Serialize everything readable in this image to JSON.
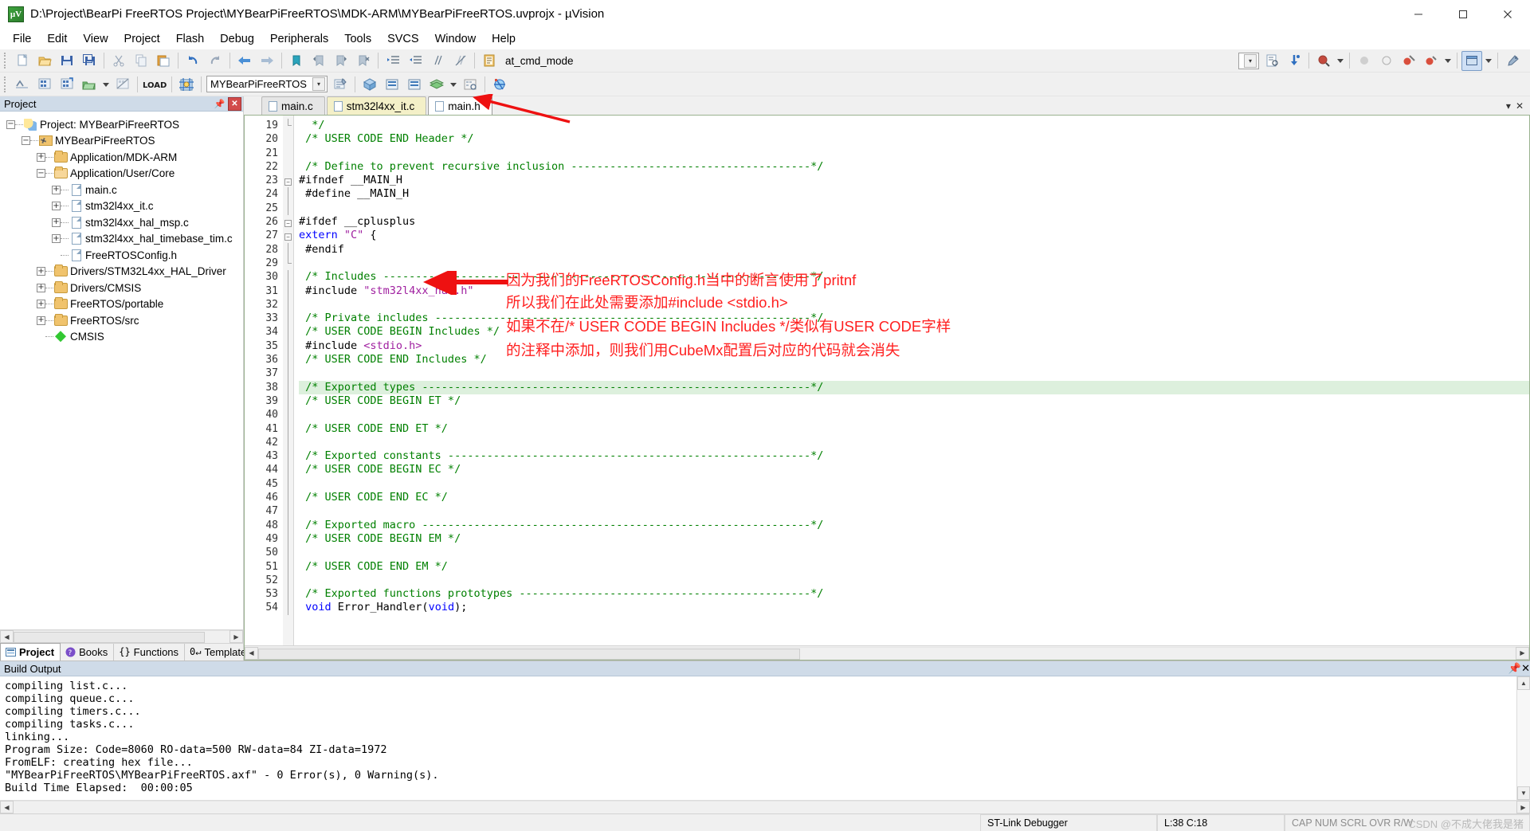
{
  "window": {
    "title": "D:\\Project\\BearPi FreeRTOS Project\\MYBearPiFreeRTOS\\MDK-ARM\\MYBearPiFreeRTOS.uvprojx - µVision",
    "app_icon": "uvision-icon",
    "minimize": "−",
    "maximize": "❐",
    "close": "✕"
  },
  "menubar": {
    "items": [
      {
        "label": "File"
      },
      {
        "label": "Edit"
      },
      {
        "label": "View"
      },
      {
        "label": "Project"
      },
      {
        "label": "Flash"
      },
      {
        "label": "Debug"
      },
      {
        "label": "Peripherals"
      },
      {
        "label": "Tools"
      },
      {
        "label": "SVCS"
      },
      {
        "label": "Window"
      },
      {
        "label": "Help"
      }
    ]
  },
  "toolbar1": {
    "combo_value": "at_cmd_mode",
    "buttons": [
      "new-file-icon",
      "open-file-icon",
      "save-icon",
      "save-all-icon",
      "cut-icon",
      "copy-icon",
      "paste-icon",
      "undo-icon",
      "redo-icon",
      "navigate-back-icon",
      "navigate-forward-icon",
      "bookmark-toggle-icon",
      "bookmark-prev-icon",
      "bookmark-next-icon",
      "bookmark-clear-icon",
      "indent-icon",
      "outdent-icon",
      "comment-icon",
      "uncomment-icon",
      "bookmark-list-icon",
      "find-icon",
      "debug-start-icon",
      "debug-stop-icon",
      "insert-breakpoint-icon",
      "window-layout-icon",
      "configure-icon"
    ]
  },
  "toolbar2": {
    "target_value": "MYBearPiFreeRTOS",
    "buttons": [
      "translate-icon",
      "build-icon",
      "rebuild-icon",
      "batch-build-icon",
      "stop-build-icon",
      "load-icon",
      "target-options-icon",
      "manage-project-items-icon",
      "options-icon",
      "insert-icon",
      "new-icon",
      "remove-icon"
    ]
  },
  "project_panel": {
    "caption": "Project",
    "pin_icon": "pin-icon",
    "close_icon": "close-icon",
    "tree": [
      {
        "depth": 0,
        "label": "Project: MYBearPiFreeRTOS",
        "expander": "−",
        "icon": "project-icon"
      },
      {
        "depth": 1,
        "label": "MYBearPiFreeRTOS",
        "expander": "−",
        "icon": "target-icon"
      },
      {
        "depth": 2,
        "label": "Application/MDK-ARM",
        "expander": "+",
        "icon": "folder-icon"
      },
      {
        "depth": 2,
        "label": "Application/User/Core",
        "expander": "−",
        "icon": "folder-open-icon"
      },
      {
        "depth": 3,
        "label": "main.c",
        "expander": "+",
        "icon": "file-icon"
      },
      {
        "depth": 3,
        "label": "stm32l4xx_it.c",
        "expander": "+",
        "icon": "file-icon"
      },
      {
        "depth": 3,
        "label": "stm32l4xx_hal_msp.c",
        "expander": "+",
        "icon": "file-icon"
      },
      {
        "depth": 3,
        "label": "stm32l4xx_hal_timebase_tim.c",
        "expander": "+",
        "icon": "file-icon"
      },
      {
        "depth": 3,
        "label": "FreeRTOSConfig.h",
        "expander": "",
        "icon": "file-icon"
      },
      {
        "depth": 2,
        "label": "Drivers/STM32L4xx_HAL_Driver",
        "expander": "+",
        "icon": "folder-icon"
      },
      {
        "depth": 2,
        "label": "Drivers/CMSIS",
        "expander": "+",
        "icon": "folder-icon"
      },
      {
        "depth": 2,
        "label": "FreeRTOS/portable",
        "expander": "+",
        "icon": "folder-icon"
      },
      {
        "depth": 2,
        "label": "FreeRTOS/src",
        "expander": "+",
        "icon": "folder-icon"
      },
      {
        "depth": 2,
        "label": "CMSIS",
        "expander": "",
        "icon": "cmsis-icon"
      }
    ],
    "tabs": [
      {
        "label": "Project",
        "icon": "project-tab-icon",
        "active": true
      },
      {
        "label": "Books",
        "icon": "books-icon",
        "active": false
      },
      {
        "label": "Functions",
        "icon": "functions-icon",
        "active": false
      },
      {
        "label": "Templates",
        "icon": "templates-icon",
        "active": false
      }
    ]
  },
  "editor": {
    "tabs": [
      {
        "label": "main.c",
        "state": "normal"
      },
      {
        "label": "stm32l4xx_it.c",
        "state": "modified"
      },
      {
        "label": "main.h",
        "state": "active"
      }
    ],
    "tab_nav": {
      "prev": "▾",
      "close": "✕"
    },
    "first_line": 19,
    "lines": [
      {
        "n": 19,
        "fold": "end",
        "tokens": [
          {
            "t": "  */",
            "c": "c-comment"
          }
        ]
      },
      {
        "n": 20,
        "fold": "",
        "tokens": [
          {
            "t": " /* USER CODE END Header */",
            "c": "c-comment"
          }
        ]
      },
      {
        "n": 21,
        "fold": "",
        "tokens": []
      },
      {
        "n": 22,
        "fold": "",
        "tokens": [
          {
            "t": " /* Define to prevent recursive inclusion -------------------------------------*/",
            "c": "c-comment"
          }
        ]
      },
      {
        "n": 23,
        "fold": "minus",
        "tokens": [
          {
            "t": "#ifndef __MAIN_H",
            "c": "c-pre"
          }
        ]
      },
      {
        "n": 24,
        "fold": "bar",
        "tokens": [
          {
            "t": " #define __MAIN_H",
            "c": "c-pre"
          }
        ]
      },
      {
        "n": 25,
        "fold": "bar",
        "tokens": []
      },
      {
        "n": 26,
        "fold": "minus",
        "tokens": [
          {
            "t": "#ifdef __cplusplus",
            "c": "c-pre"
          }
        ]
      },
      {
        "n": 27,
        "fold": "minus",
        "tokens": [
          {
            "t": "extern ",
            "c": "c-kw"
          },
          {
            "t": "\"C\"",
            "c": "c-str"
          },
          {
            "t": " {",
            "c": "c-plain"
          }
        ]
      },
      {
        "n": 28,
        "fold": "bar",
        "tokens": [
          {
            "t": " #endif",
            "c": "c-pre"
          }
        ]
      },
      {
        "n": 29,
        "fold": "endbar",
        "tokens": []
      },
      {
        "n": 30,
        "fold": "bar",
        "tokens": [
          {
            "t": " /* Includes ------------------------------------------------------------------*/",
            "c": "c-comment"
          }
        ]
      },
      {
        "n": 31,
        "fold": "bar",
        "tokens": [
          {
            "t": " #include ",
            "c": "c-pre"
          },
          {
            "t": "\"stm32l4xx_hal.h\"",
            "c": "c-str"
          }
        ]
      },
      {
        "n": 32,
        "fold": "bar",
        "tokens": []
      },
      {
        "n": 33,
        "fold": "bar",
        "tokens": [
          {
            "t": " /* Private includes ----------------------------------------------------------*/",
            "c": "c-comment"
          }
        ]
      },
      {
        "n": 34,
        "fold": "bar",
        "tokens": [
          {
            "t": " /* USER CODE BEGIN Includes */",
            "c": "c-comment"
          }
        ]
      },
      {
        "n": 35,
        "fold": "bar",
        "tokens": [
          {
            "t": " #include ",
            "c": "c-pre"
          },
          {
            "t": "<stdio.h>",
            "c": "c-str"
          }
        ]
      },
      {
        "n": 36,
        "fold": "bar",
        "tokens": [
          {
            "t": " /* USER CODE END Includes */",
            "c": "c-comment"
          }
        ]
      },
      {
        "n": 37,
        "fold": "bar",
        "tokens": []
      },
      {
        "n": 38,
        "fold": "bar",
        "highlight": true,
        "tokens": [
          {
            "t": " /* Exported types ------------------------------------------------------------*/",
            "c": "c-comment"
          }
        ]
      },
      {
        "n": 39,
        "fold": "bar",
        "tokens": [
          {
            "t": " /* USER CODE BEGIN ET */",
            "c": "c-comment"
          }
        ]
      },
      {
        "n": 40,
        "fold": "bar",
        "tokens": []
      },
      {
        "n": 41,
        "fold": "bar",
        "tokens": [
          {
            "t": " /* USER CODE END ET */",
            "c": "c-comment"
          }
        ]
      },
      {
        "n": 42,
        "fold": "bar",
        "tokens": []
      },
      {
        "n": 43,
        "fold": "bar",
        "tokens": [
          {
            "t": " /* Exported constants --------------------------------------------------------*/",
            "c": "c-comment"
          }
        ]
      },
      {
        "n": 44,
        "fold": "bar",
        "tokens": [
          {
            "t": " /* USER CODE BEGIN EC */",
            "c": "c-comment"
          }
        ]
      },
      {
        "n": 45,
        "fold": "bar",
        "tokens": []
      },
      {
        "n": 46,
        "fold": "bar",
        "tokens": [
          {
            "t": " /* USER CODE END EC */",
            "c": "c-comment"
          }
        ]
      },
      {
        "n": 47,
        "fold": "bar",
        "tokens": []
      },
      {
        "n": 48,
        "fold": "bar",
        "tokens": [
          {
            "t": " /* Exported macro ------------------------------------------------------------*/",
            "c": "c-comment"
          }
        ]
      },
      {
        "n": 49,
        "fold": "bar",
        "tokens": [
          {
            "t": " /* USER CODE BEGIN EM */",
            "c": "c-comment"
          }
        ]
      },
      {
        "n": 50,
        "fold": "bar",
        "tokens": []
      },
      {
        "n": 51,
        "fold": "bar",
        "tokens": [
          {
            "t": " /* USER CODE END EM */",
            "c": "c-comment"
          }
        ]
      },
      {
        "n": 52,
        "fold": "bar",
        "tokens": []
      },
      {
        "n": 53,
        "fold": "bar",
        "tokens": [
          {
            "t": " /* Exported functions prototypes ---------------------------------------------*/",
            "c": "c-comment"
          }
        ]
      },
      {
        "n": 54,
        "fold": "bar",
        "tokens": [
          {
            "t": " void",
            "c": "c-kw"
          },
          {
            "t": " Error_Handler(",
            "c": "c-plain"
          },
          {
            "t": "void",
            "c": "c-kw"
          },
          {
            "t": ");",
            "c": "c-plain"
          }
        ]
      }
    ]
  },
  "annotations": {
    "color": "#ff2020",
    "tab_arrow": "arrow-to-main-h-tab",
    "include_arrow": "arrow-to-stdio-include",
    "lines": [
      "因为我们的FreeRTOSConfig.h当中的断言使用了pritnf",
      "所以我们在此处需要添加#include <stdio.h>",
      "如果不在/* USER CODE BEGIN Includes */类似有USER CODE字样",
      "的注释中添加，则我们用CubeMx配置后对应的代码就会消失"
    ]
  },
  "build_output": {
    "caption": "Build Output",
    "pin_icon": "pin-icon",
    "close_icon": "close-icon",
    "text": "compiling list.c...\ncompiling queue.c...\ncompiling timers.c...\ncompiling tasks.c...\nlinking...\nProgram Size: Code=8060 RO-data=500 RW-data=84 ZI-data=1972\nFromELF: creating hex file...\n\"MYBearPiFreeRTOS\\MYBearPiFreeRTOS.axf\" - 0 Error(s), 0 Warning(s).\nBuild Time Elapsed:  00:00:05"
  },
  "statusbar": {
    "debugger": "ST-Link Debugger",
    "cursor": "L:38 C:18",
    "indicators": "CAP NUM SCRL OVR R/W",
    "watermark": "CSDN @不成大佬我是猪"
  }
}
